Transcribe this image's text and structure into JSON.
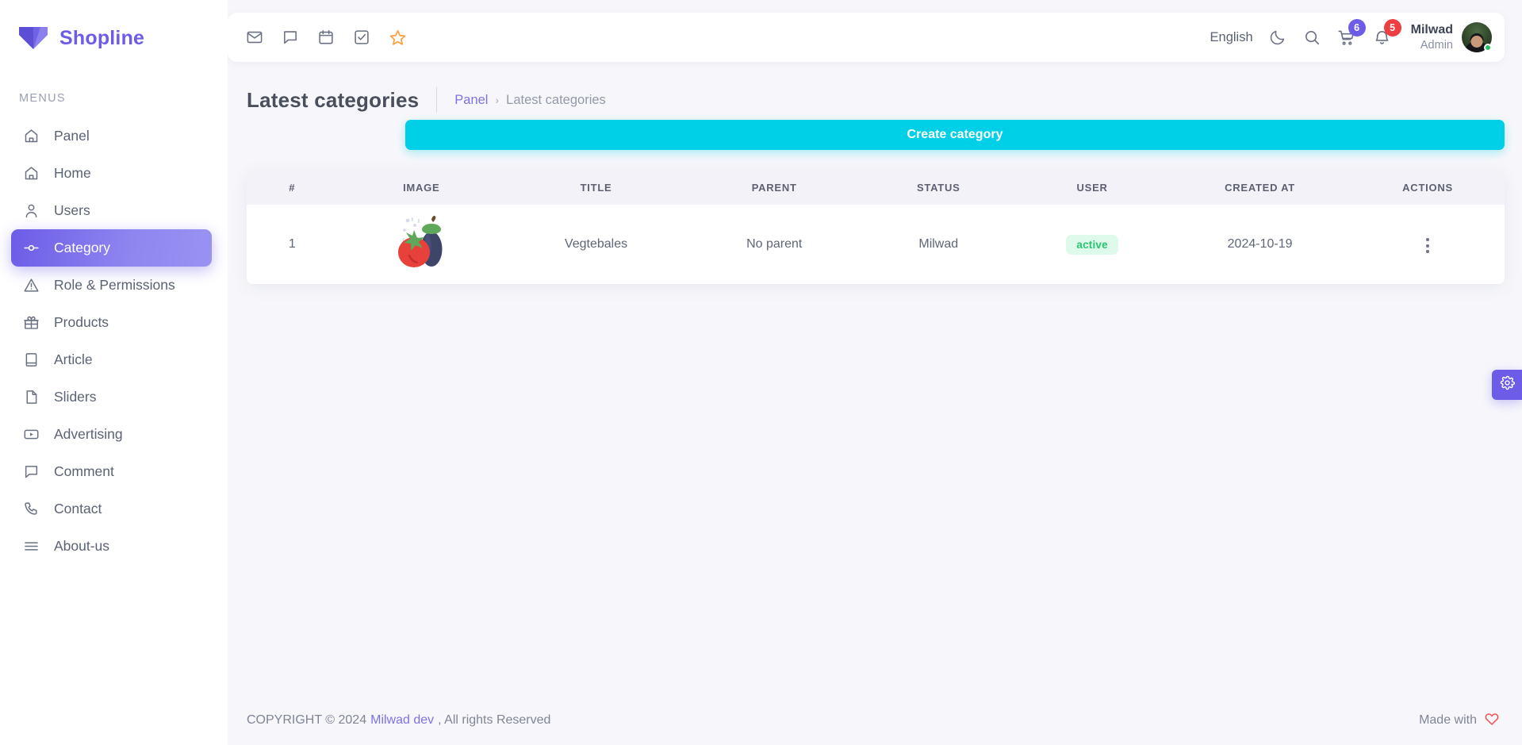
{
  "brand": {
    "name": "Shopline",
    "logo_icon": "shopline-heart-logo",
    "color": "#6c5ce7"
  },
  "sidebar": {
    "section_label": "MENUS",
    "items": [
      {
        "label": "Panel",
        "icon": "home-icon",
        "active": false
      },
      {
        "label": "Home",
        "icon": "home-icon",
        "active": false
      },
      {
        "label": "Users",
        "icon": "user-icon",
        "active": false
      },
      {
        "label": "Category",
        "icon": "node-icon",
        "active": true
      },
      {
        "label": "Role & Permissions",
        "icon": "warning-icon",
        "active": false
      },
      {
        "label": "Products",
        "icon": "gift-icon",
        "active": false
      },
      {
        "label": "Article",
        "icon": "book-icon",
        "active": false
      },
      {
        "label": "Sliders",
        "icon": "file-icon",
        "active": false
      },
      {
        "label": "Advertising",
        "icon": "video-icon",
        "active": false
      },
      {
        "label": "Comment",
        "icon": "chat-icon",
        "active": false
      },
      {
        "label": "Contact",
        "icon": "phone-icon",
        "active": false
      },
      {
        "label": "About-us",
        "icon": "menu-lines-icon",
        "active": false
      }
    ]
  },
  "topbar": {
    "left_icons": [
      "mail-icon",
      "chat-icon",
      "calendar-icon",
      "checklist-icon",
      "star-icon"
    ],
    "star_color": "#ff9f43",
    "language": "English",
    "theme_icon": "moon-icon",
    "search_icon": "search-icon",
    "cart_icon": "cart-icon",
    "cart_badge": "6",
    "cart_badge_color": "#6c5ce7",
    "bell_icon": "bell-icon",
    "bell_badge": "5",
    "bell_badge_color": "#ef3d40",
    "user_name": "Milwad",
    "user_role": "Admin",
    "status": "online"
  },
  "page": {
    "title": "Latest categories",
    "breadcrumb": {
      "parent": "Panel",
      "separator": "›",
      "current": "Latest categories"
    },
    "create_button": "Create category",
    "create_button_color": "#00cfe8"
  },
  "table": {
    "columns": [
      "#",
      "IMAGE",
      "TITLE",
      "PARENT",
      "STATUS",
      "USER",
      "CREATED AT",
      "ACTIONS"
    ],
    "rows": [
      {
        "index": "1",
        "image_icon": "tomato-eggplant-thumbnail",
        "title": "Vegtebales",
        "parent": "No parent",
        "status": "Milwad",
        "user": "active",
        "created_at": "2024-10-19",
        "actions_icon": "more-vertical-icon"
      }
    ],
    "status_badge_bg": "#defaeb",
    "status_badge_color": "#28c76f"
  },
  "footer": {
    "copyright": "COPYRIGHT © 2024",
    "link": "Milwad dev",
    "rights": ", All rights Reserved",
    "made_with": "Made with",
    "heart_icon": "heart-icon",
    "heart_color": "#ea5455"
  },
  "fab": {
    "icon": "gear-icon",
    "color": "#6c5ce7"
  }
}
